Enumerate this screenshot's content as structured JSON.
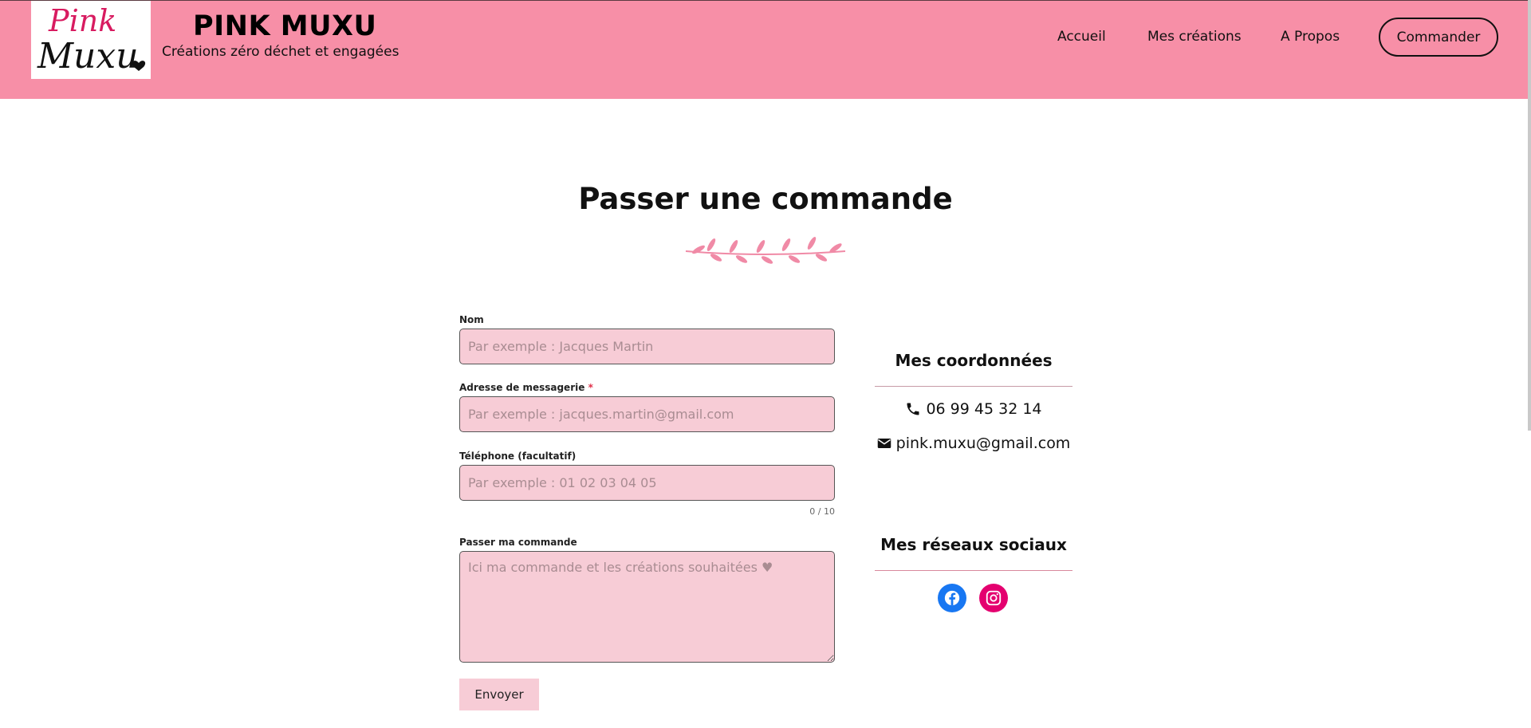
{
  "header": {
    "logo_text_top": "Pink",
    "logo_text_bottom": "Muxu",
    "site_title": "PINK MUXU",
    "tagline": "Créations zéro déchet et engagées",
    "background_color": "#f78fa7"
  },
  "nav": {
    "items": [
      {
        "label": "Accueil"
      },
      {
        "label": "Mes créations"
      },
      {
        "label": "A Propos"
      }
    ],
    "cta_label": "Commander"
  },
  "main": {
    "title": "Passer une commande"
  },
  "form": {
    "name_label": "Nom",
    "name_placeholder": "Par exemple : Jacques Martin",
    "email_label": "Adresse de messagerie",
    "email_required_marker": "*",
    "email_placeholder": "Par exemple : jacques.martin@gmail.com",
    "phone_label": "Téléphone (facultatif)",
    "phone_placeholder": "Par exemple : 01 02 03 04 05",
    "phone_counter": "0 / 10",
    "order_label": "Passer ma commande",
    "order_placeholder": "Ici ma commande et les créations souhaitées ♥",
    "submit_label": "Envoyer",
    "field_bg_color": "#f7ccd6"
  },
  "sidebar": {
    "contact_heading": "Mes coordonnées",
    "phone": "06 99 45 32 14",
    "email": "pink.muxu@gmail.com",
    "social_heading": "Mes réseaux sociaux",
    "socials": [
      {
        "name": "facebook-icon",
        "color": "#1877f2"
      },
      {
        "name": "instagram-icon",
        "color": "#e4006f"
      }
    ]
  }
}
